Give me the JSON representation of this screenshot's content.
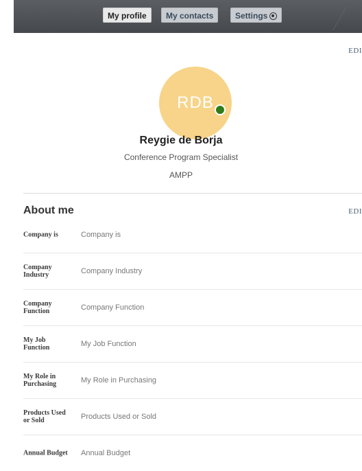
{
  "nav": {
    "my_profile": "My profile",
    "my_contacts": "My contacts",
    "settings": "Settings"
  },
  "profile": {
    "edit_label": "EDI",
    "initials": "RDB",
    "name": "Reygie de Borja",
    "title": "Conference Program Specialist",
    "organization": "AMPP",
    "avatar_color": "#f7d48a",
    "status_color": "#2f7d1a"
  },
  "about": {
    "heading": "About me",
    "edit_label": "EDI",
    "fields": [
      {
        "label": "Company is",
        "value": "Company is"
      },
      {
        "label": "Company Industry",
        "value": "Company Industry"
      },
      {
        "label": "Company Function",
        "value": "Company Function"
      },
      {
        "label": "My Job Function",
        "value": "My Job Function"
      },
      {
        "label": "My Role in Purchasing",
        "value": "My Role in Purchasing"
      },
      {
        "label": "Products Used or Sold",
        "value": "Products Used or Sold"
      },
      {
        "label": "Annual Budget",
        "value": "Annual Budget"
      }
    ]
  }
}
